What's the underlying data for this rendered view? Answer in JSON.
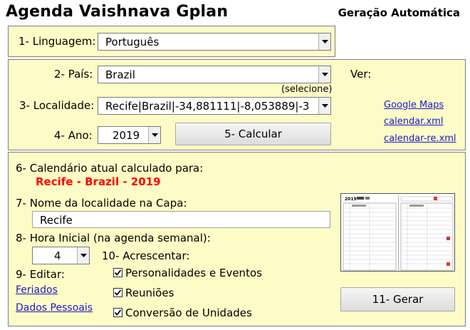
{
  "header": {
    "title": "Agenda Vaishnava Gplan",
    "subtitle": "Geração Automática"
  },
  "language": {
    "label": "1- Linguagem:",
    "value": "Português"
  },
  "country": {
    "label": "2- País:",
    "value": "Brazil",
    "hint": "(selecione)"
  },
  "location": {
    "label": "3- Localidade:",
    "value": "Recife|Brazil|-34,881111|-8,053889|-3"
  },
  "year": {
    "label": "4- Ano:",
    "value": "2019"
  },
  "calculate_button": "5- Calcular",
  "ver": {
    "label": "Ver:",
    "links": [
      "Google Maps",
      "calendar.xml",
      "calendar-re.xml"
    ]
  },
  "current": {
    "label": "6- Calendário atual calculado para:",
    "value": "Recife - Brazil - 2019"
  },
  "cover_name": {
    "label": "7- Nome da localidade na Capa:",
    "value": "Recife"
  },
  "start_hour": {
    "label": "8- Hora Inicial (na agenda semanal):",
    "value": "4"
  },
  "add": {
    "label": "10- Acrescentar:",
    "options": [
      {
        "label": "Personalidades e Eventos",
        "checked": true
      },
      {
        "label": "Reuniões",
        "checked": true
      },
      {
        "label": "Conversão de Unidades",
        "checked": true
      }
    ]
  },
  "edit": {
    "label": "9- Editar:",
    "links": [
      "Feriados",
      "Dados Pessoais"
    ]
  },
  "thumbnail": {
    "year_text": "2019"
  },
  "generate_button": "11- Gerar",
  "colors": {
    "panel_bg": "#fefcc6",
    "highlight_red": "#ff0000",
    "link_blue": "#1a1acc"
  }
}
